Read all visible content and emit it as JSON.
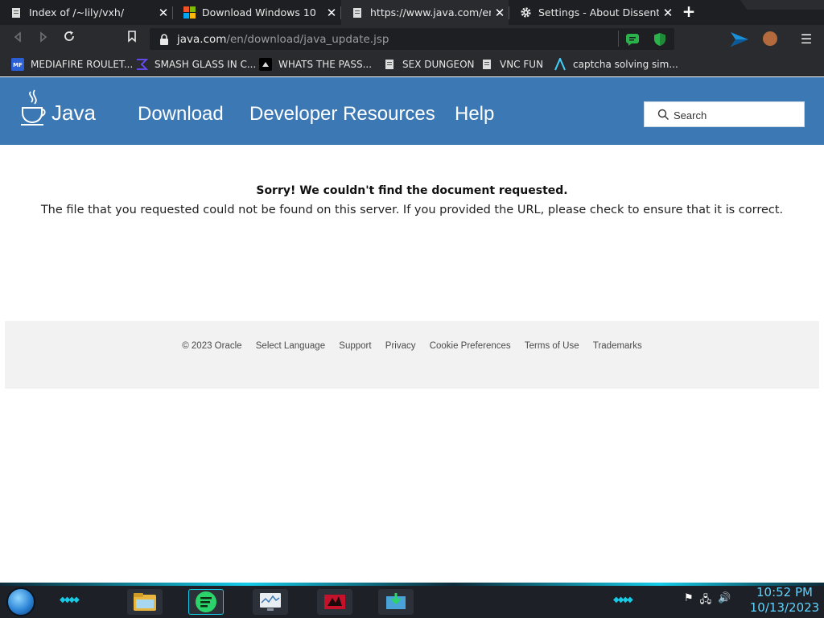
{
  "browser": {
    "tabs": [
      {
        "title": "Index of /~lily/vxh/",
        "icon": "document-icon"
      },
      {
        "title": "Download Windows 10",
        "icon": "windows-logo-icon"
      },
      {
        "title": "https://www.java.com/en/do",
        "icon": "document-icon"
      },
      {
        "title": "Settings - About Dissenter",
        "icon": "gear-icon"
      }
    ],
    "url": {
      "host": "java.com",
      "path": "/en/download/java_update.jsp"
    },
    "bookmarks": [
      {
        "label": "MEDIAFIRE ROULET..."
      },
      {
        "label": "SMASH GLASS IN C..."
      },
      {
        "label": "WHATS THE PASS..."
      },
      {
        "label": "SEX DUNGEON"
      },
      {
        "label": "VNC FUN"
      },
      {
        "label": "captcha solving sim..."
      }
    ]
  },
  "site": {
    "logo_text": "Java",
    "nav": [
      "Download",
      "Developer Resources",
      "Help"
    ],
    "search_placeholder": "Search"
  },
  "content": {
    "title": "Sorry! We couldn't find the document requested.",
    "body": "The file that you requested could not be found on this server. If you provided the URL, please check to ensure that it is correct."
  },
  "footer": {
    "links": [
      "© 2023 Oracle",
      "Select Language",
      "Support",
      "Privacy",
      "Cookie Preferences",
      "Terms of Use",
      "Trademarks"
    ]
  },
  "taskbar": {
    "time": "10:52 PM",
    "date": "10/13/2023"
  },
  "colors": {
    "java_blue": "#3b78b4",
    "accent_cyan": "#16cbe8"
  }
}
